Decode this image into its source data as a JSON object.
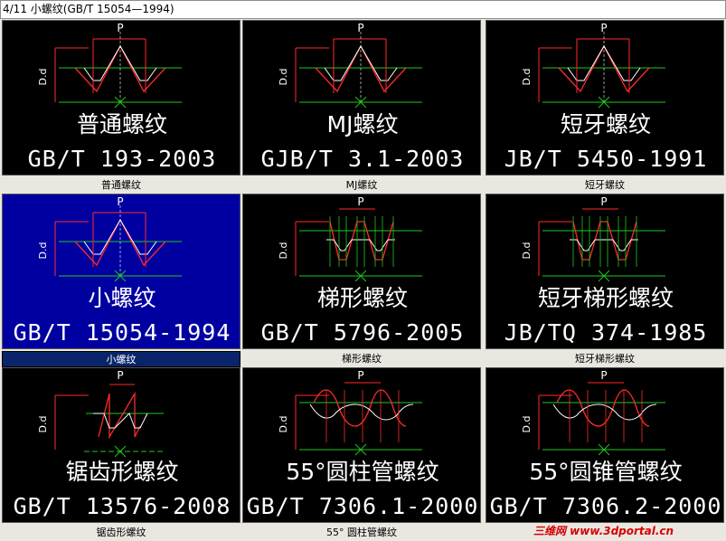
{
  "window": {
    "title": "4/11 小螺纹(GB/T 15054—1994)"
  },
  "thumbnail_labels": {
    "pitch": "P",
    "diameter": "D.d"
  },
  "colors": {
    "profile": "#ff2a2a",
    "outline": "#ffffff",
    "baseline": "#1ec81e",
    "dimension": "#ff2a2a",
    "selected_bg": "#0000a0"
  },
  "items": [
    {
      "name": "普通螺纹",
      "code": "GB/T 193-2003",
      "caption": "普通螺纹",
      "profile": "v-thread",
      "selected": false
    },
    {
      "name": "MJ螺纹",
      "code": "GJB/T 3.1-2003",
      "caption": "MJ螺纹",
      "profile": "v-thread",
      "selected": false
    },
    {
      "name": "短牙螺纹",
      "code": "JB/T 5450-1991",
      "caption": "短牙螺纹",
      "profile": "v-thread",
      "selected": false
    },
    {
      "name": "小螺纹",
      "code": "GB/T 15054-1994",
      "caption": "小螺纹",
      "profile": "v-thread",
      "selected": true
    },
    {
      "name": "梯形螺纹",
      "code": "GB/T 5796-2005",
      "caption": "梯形螺纹",
      "profile": "trapezoid",
      "selected": false
    },
    {
      "name": "短牙梯形螺纹",
      "code": "JB/TQ 374-1985",
      "caption": "短牙梯形螺纹",
      "profile": "trapezoid",
      "selected": false
    },
    {
      "name": "锯齿形螺纹",
      "code": "GB/T 13576-2008",
      "caption": "锯齿形螺纹",
      "profile": "buttress",
      "selected": false
    },
    {
      "name": "55°圆柱管螺纹",
      "code": "GB/T 7306.1-2000",
      "caption": "55° 圆柱管螺纹",
      "profile": "pipe",
      "selected": false
    },
    {
      "name": "55°圆锥管螺纹",
      "code": "GB/T 7306.2-2000",
      "caption": "",
      "profile": "pipe",
      "selected": false
    }
  ],
  "watermark": "三维网 www.3dportal.cn"
}
